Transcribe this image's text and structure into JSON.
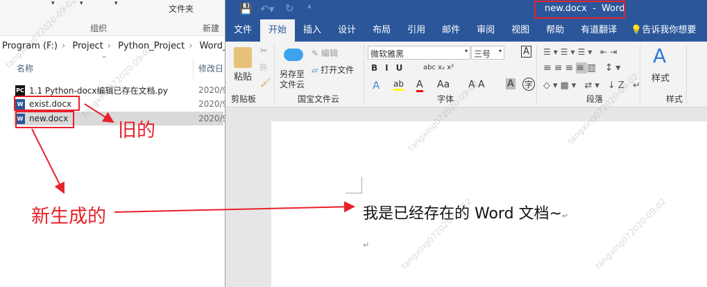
{
  "explorer": {
    "ribbon_groups": [
      "组织",
      "新建"
    ],
    "ribbon_folder_label": "文件夹",
    "breadcrumb": [
      "Program (F:)",
      "Project",
      "Python_Project",
      "Word_Au"
    ],
    "columns": {
      "name": "名称",
      "modified": "修改日"
    },
    "files": [
      {
        "name": "1.1 Python-docx编辑已存在文档.py",
        "date": "2020/9",
        "icon": "pycharm-file-icon"
      },
      {
        "name": "exist.docx",
        "date": "2020/9",
        "icon": "word-file-icon"
      },
      {
        "name": "new.docx",
        "date": "2020/9",
        "icon": "word-file-icon",
        "selected": true
      }
    ]
  },
  "word": {
    "title": "new.docx  -  Word",
    "tabs": [
      "文件",
      "开始",
      "插入",
      "设计",
      "布局",
      "引用",
      "邮件",
      "审阅",
      "视图",
      "帮助",
      "有道翻译"
    ],
    "active_tab": "开始",
    "tell_me": "告诉我你想要",
    "ribbon": {
      "paste": "粘贴",
      "save_cloud": "另存至\n文件云",
      "edit": "编辑",
      "open_file": "打开文件",
      "font_name": "微软雅黑",
      "font_size": "三号",
      "styles": "样式",
      "groups": [
        "剪贴板",
        "国宝文件云",
        "字体",
        "段落",
        "样式"
      ]
    },
    "document_text": "我是已经存在的 Word 文档~",
    "para_mark": "↵"
  },
  "annotations": {
    "old": "旧的",
    "new": "新生成的",
    "color": "#e8202a"
  },
  "watermark": "tangxing072020-09-02"
}
